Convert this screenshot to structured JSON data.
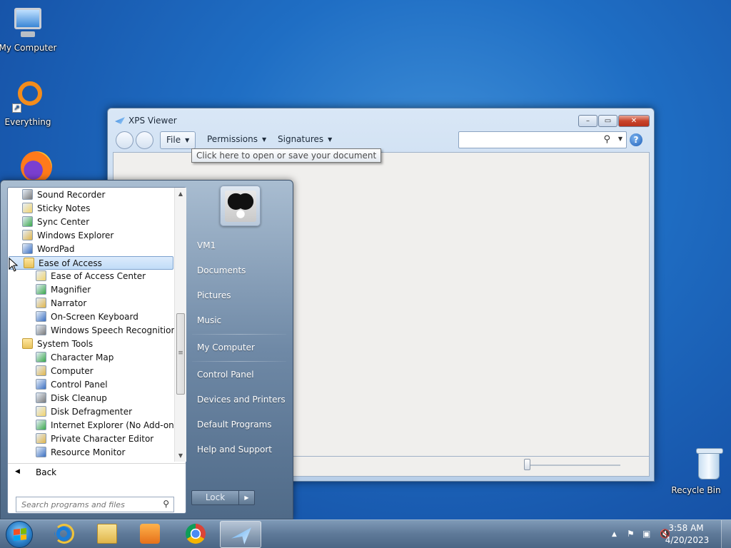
{
  "desktop": {
    "icons": [
      {
        "label": "My Computer"
      },
      {
        "label": "Everything"
      },
      {
        "label": "Recycle Bin"
      }
    ]
  },
  "xps_viewer": {
    "title": "XPS Viewer",
    "menus": {
      "file": "File",
      "permissions": "Permissions",
      "signatures": "Signatures"
    },
    "search_value": "",
    "tooltip": "Click here to open or save your document"
  },
  "start_menu": {
    "programs": [
      {
        "label": "Sound Recorder",
        "indent": 0
      },
      {
        "label": "Sticky Notes",
        "indent": 0
      },
      {
        "label": "Sync Center",
        "indent": 0
      },
      {
        "label": "Windows Explorer",
        "indent": 0
      },
      {
        "label": "WordPad",
        "indent": 0
      },
      {
        "label": "Ease of Access",
        "indent": 0,
        "selected": true,
        "folder": true
      },
      {
        "label": "Ease of Access Center",
        "indent": 1
      },
      {
        "label": "Magnifier",
        "indent": 1
      },
      {
        "label": "Narrator",
        "indent": 1
      },
      {
        "label": "On-Screen Keyboard",
        "indent": 1
      },
      {
        "label": "Windows Speech Recognition",
        "indent": 1
      },
      {
        "label": "System Tools",
        "indent": 0,
        "folder": true
      },
      {
        "label": "Character Map",
        "indent": 1
      },
      {
        "label": "Computer",
        "indent": 1
      },
      {
        "label": "Control Panel",
        "indent": 1
      },
      {
        "label": "Disk Cleanup",
        "indent": 1
      },
      {
        "label": "Disk Defragmenter",
        "indent": 1
      },
      {
        "label": "Internet Explorer (No Add-ons)",
        "indent": 1
      },
      {
        "label": "Private Character Editor",
        "indent": 1
      },
      {
        "label": "Resource Monitor",
        "indent": 1
      }
    ],
    "back_label": "Back",
    "search_placeholder": "Search programs and files",
    "user_name": "VM1",
    "right_links": {
      "documents": "Documents",
      "pictures": "Pictures",
      "music": "Music",
      "my_computer": "My Computer",
      "control_panel": "Control Panel",
      "devices_printers": "Devices and Printers",
      "default_programs": "Default Programs",
      "help_support": "Help and Support"
    },
    "lock_label": "Lock"
  },
  "taskbar": {
    "apps": [
      {
        "icon": "internet-explorer-icon"
      },
      {
        "icon": "windows-explorer-icon"
      },
      {
        "icon": "media-player-icon"
      },
      {
        "icon": "chrome-icon"
      },
      {
        "icon": "xps-viewer-icon",
        "active": true
      }
    ],
    "clock_time": "3:58 AM",
    "clock_date": "4/20/2023"
  },
  "colors": {
    "desktop_bg": "#1f6ec4",
    "selection": "#c1dcf7",
    "close_button": "#c9452c"
  }
}
